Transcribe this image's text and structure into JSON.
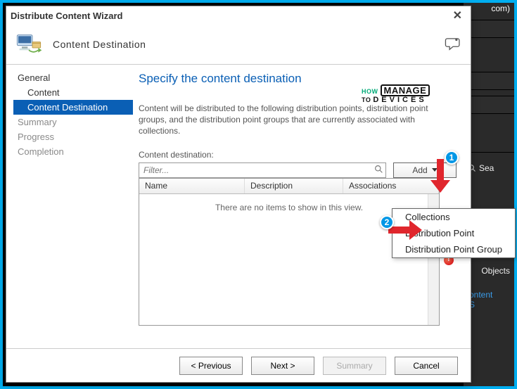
{
  "bg": {
    "com_suffix": "com)",
    "search_label": "Sea",
    "objects_label": "Objects",
    "content_label": "ontent S"
  },
  "wizard": {
    "title": "Distribute Content Wizard",
    "header_label": "Content Destination"
  },
  "sidebar": {
    "items": [
      {
        "label": "General",
        "cls": "top"
      },
      {
        "label": "Content",
        "cls": "indent"
      },
      {
        "label": "Content Destination",
        "cls": "indent selected"
      },
      {
        "label": "Summary",
        "cls": "muted"
      },
      {
        "label": "Progress",
        "cls": "muted"
      },
      {
        "label": "Completion",
        "cls": "muted"
      }
    ]
  },
  "main": {
    "heading": "Specify the content destination",
    "description": "Content will be distributed to the following distribution points, distribution point groups, and the distribution point groups that are currently associated with collections.",
    "dest_label": "Content destination:",
    "filter_placeholder": "Filter...",
    "add_label": "Add",
    "columns": {
      "c1": "Name",
      "c2": "Description",
      "c3": "Associations"
    },
    "empty_text": "There are no items to show in this view."
  },
  "menu": {
    "items": [
      {
        "label": "Collections"
      },
      {
        "label": "Distribution Point"
      },
      {
        "label": "Distribution Point Group"
      }
    ]
  },
  "footer": {
    "previous": "< Previous",
    "next": "Next >",
    "summary": "Summary",
    "cancel": "Cancel"
  },
  "annotations": {
    "badge1": "1",
    "badge2": "2"
  },
  "watermark": {
    "how": "HOW",
    "to": "TO",
    "manage": "MANAGE",
    "devices": "DEVICES"
  }
}
